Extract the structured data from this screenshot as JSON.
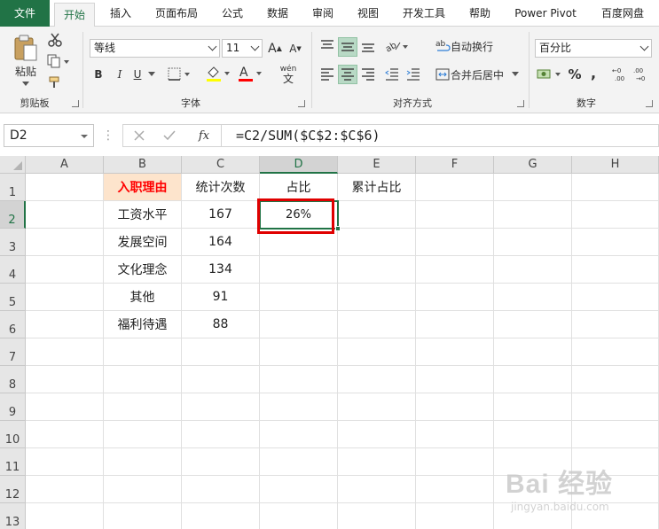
{
  "tabs": [
    {
      "label": "文件",
      "name": "tab-file"
    },
    {
      "label": "开始",
      "name": "tab-home"
    },
    {
      "label": "插入",
      "name": "tab-insert"
    },
    {
      "label": "页面布局",
      "name": "tab-page-layout"
    },
    {
      "label": "公式",
      "name": "tab-formulas"
    },
    {
      "label": "数据",
      "name": "tab-data"
    },
    {
      "label": "审阅",
      "name": "tab-review"
    },
    {
      "label": "视图",
      "name": "tab-view"
    },
    {
      "label": "开发工具",
      "name": "tab-developer"
    },
    {
      "label": "帮助",
      "name": "tab-help"
    },
    {
      "label": "Power Pivot",
      "name": "tab-power-pivot"
    },
    {
      "label": "百度网盘",
      "name": "tab-baidu-netdisk"
    }
  ],
  "ribbon": {
    "clipboard": {
      "label": "剪贴板",
      "paste_label": "粘贴"
    },
    "font": {
      "label": "字体",
      "font_name": "等线",
      "font_size": "11",
      "bold": "B",
      "italic": "I",
      "underline": "U",
      "grow": "A",
      "shrink": "A",
      "phonetic": "wén"
    },
    "alignment": {
      "label": "对齐方式",
      "wrap_text": "自动换行",
      "merge_center": "合并后居中"
    },
    "number": {
      "label": "数字",
      "format": "百分比",
      "percent": "%",
      "comma": ","
    }
  },
  "formula_bar": {
    "name_box": "D2",
    "fx": "fx",
    "formula": "=C2/SUM($C$2:$C$6)"
  },
  "sheet": {
    "columns": [
      "A",
      "B",
      "C",
      "D",
      "E",
      "F",
      "G",
      "H"
    ],
    "rows": [
      "1",
      "2",
      "3",
      "4",
      "5",
      "6",
      "7",
      "8",
      "9",
      "10",
      "11",
      "12",
      "13"
    ],
    "header_row": [
      "",
      "入职理由",
      "统计次数",
      "占比",
      "累计占比"
    ],
    "data": [
      [
        "工资水平",
        "167",
        "26%"
      ],
      [
        "发展空间",
        "164",
        ""
      ],
      [
        "文化理念",
        "134",
        ""
      ],
      [
        "其他",
        "91",
        ""
      ],
      [
        "福利待遇",
        "88",
        ""
      ]
    ]
  },
  "watermark": {
    "text": "Bai 经验",
    "sub": "jingyan.baidu.com"
  }
}
